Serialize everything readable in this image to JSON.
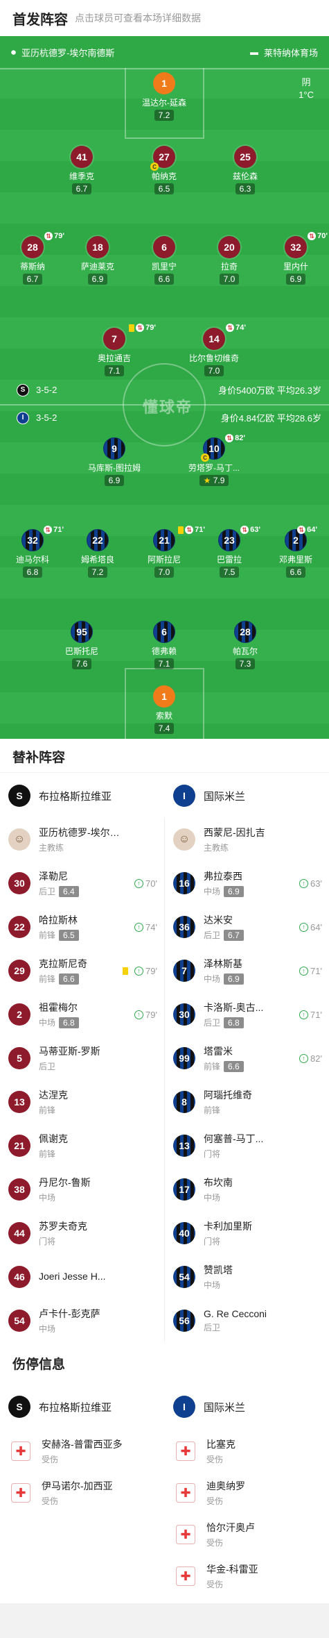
{
  "header": {
    "title": "首发阵容",
    "subtitle": "点击球员可查看本场详细数据"
  },
  "pitch": {
    "home_coach_label": "亚历杭德罗-埃尔南德斯",
    "stadium": "莱特纳体育场",
    "weather": {
      "condition": "阴",
      "temp": "1°C"
    },
    "watermark": "懂球帝",
    "home_formation": "3-5-2",
    "away_formation": "3-5-2",
    "home_stats": "身价5400万欧  平均26.3岁",
    "away_stats": "身价4.84亿欧  平均28.6岁",
    "home_logo": "S",
    "away_logo": "I"
  },
  "home_players": [
    {
      "num": "1",
      "name": "温达尔-延森",
      "rating": "7.2",
      "gk": true
    },
    {
      "num": "41",
      "name": "维季克",
      "rating": "6.7"
    },
    {
      "num": "27",
      "name": "帕纳克",
      "rating": "6.5",
      "captain": true
    },
    {
      "num": "25",
      "name": "兹伦森",
      "rating": "6.3"
    },
    {
      "num": "28",
      "name": "蒂斯纳",
      "rating": "6.7",
      "sub": "79'"
    },
    {
      "num": "18",
      "name": "萨迪莱克",
      "rating": "6.9"
    },
    {
      "num": "6",
      "name": "凯里宁",
      "rating": "6.6"
    },
    {
      "num": "20",
      "name": "拉奇",
      "rating": "7.0"
    },
    {
      "num": "32",
      "name": "里内什",
      "rating": "6.9",
      "sub": "70'"
    },
    {
      "num": "7",
      "name": "奥拉通吉",
      "rating": "7.1",
      "sub": "79'",
      "yellow": true
    },
    {
      "num": "14",
      "name": "比尔鲁切维奇",
      "rating": "7.0",
      "sub": "74'"
    }
  ],
  "away_players": [
    {
      "num": "9",
      "name": "马库斯-图拉姆",
      "rating": "6.9"
    },
    {
      "num": "10",
      "name": "劳塔罗-马丁...",
      "rating": "7.9",
      "sub": "82'",
      "captain": true,
      "star": true
    },
    {
      "num": "32",
      "name": "迪马尔科",
      "rating": "6.8",
      "sub": "71'"
    },
    {
      "num": "22",
      "name": "姆希塔良",
      "rating": "7.2"
    },
    {
      "num": "21",
      "name": "阿斯拉尼",
      "rating": "7.0",
      "sub": "71'",
      "yellow": true
    },
    {
      "num": "23",
      "name": "巴雷拉",
      "rating": "7.5",
      "sub": "63'"
    },
    {
      "num": "2",
      "name": "邓弗里斯",
      "rating": "6.6",
      "sub": "64'"
    },
    {
      "num": "95",
      "name": "巴斯托尼",
      "rating": "7.6"
    },
    {
      "num": "6",
      "name": "德弗赖",
      "rating": "7.1"
    },
    {
      "num": "28",
      "name": "帕瓦尔",
      "rating": "7.3"
    },
    {
      "num": "1",
      "name": "索默",
      "rating": "7.4",
      "gk": true
    }
  ],
  "subs_section": {
    "title": "替补阵容",
    "home_team": "布拉格斯拉维亚",
    "away_team": "国际米兰",
    "home_coach": {
      "name": "亚历杭德罗-埃尔南德斯",
      "role": "主教练"
    },
    "away_coach": {
      "name": "西蒙尼-因扎吉",
      "role": "主教练"
    },
    "home": [
      {
        "num": "30",
        "name": "泽勒尼",
        "pos": "后卫",
        "rating": "6.4",
        "in": "70'"
      },
      {
        "num": "22",
        "name": "哈拉斯林",
        "pos": "前锋",
        "rating": "6.5",
        "in": "74'"
      },
      {
        "num": "29",
        "name": "克拉斯尼奇",
        "pos": "前锋",
        "rating": "6.6",
        "in": "79'",
        "yellow": true
      },
      {
        "num": "2",
        "name": "祖霍梅尔",
        "pos": "中场",
        "rating": "6.8",
        "in": "79'"
      },
      {
        "num": "5",
        "name": "马蒂亚斯-罗斯",
        "pos": "后卫"
      },
      {
        "num": "13",
        "name": "达涅克",
        "pos": "前锋"
      },
      {
        "num": "21",
        "name": "佩谢克",
        "pos": "前锋"
      },
      {
        "num": "38",
        "name": "丹尼尔-鲁斯",
        "pos": "中场"
      },
      {
        "num": "44",
        "name": "苏罗夫奇克",
        "pos": "门将"
      },
      {
        "num": "46",
        "name": "Joeri Jesse H...",
        "pos": ""
      },
      {
        "num": "54",
        "name": "卢卡什-彭克萨",
        "pos": "中场"
      }
    ],
    "away": [
      {
        "num": "16",
        "name": "弗拉泰西",
        "pos": "中场",
        "rating": "6.9",
        "in": "63'"
      },
      {
        "num": "36",
        "name": "达米安",
        "pos": "后卫",
        "rating": "6.7",
        "in": "64'"
      },
      {
        "num": "7",
        "name": "泽林斯基",
        "pos": "中场",
        "rating": "6.9",
        "in": "71'"
      },
      {
        "num": "30",
        "name": "卡洛斯-奥古...",
        "pos": "后卫",
        "rating": "6.8",
        "in": "71'"
      },
      {
        "num": "99",
        "name": "塔雷米",
        "pos": "前锋",
        "rating": "6.6",
        "in": "82'"
      },
      {
        "num": "8",
        "name": "阿瑙托维奇",
        "pos": "前锋"
      },
      {
        "num": "13",
        "name": "何塞普-马丁...",
        "pos": "门将"
      },
      {
        "num": "17",
        "name": "布坎南",
        "pos": "中场"
      },
      {
        "num": "40",
        "name": "卡利加里斯",
        "pos": "门将"
      },
      {
        "num": "54",
        "name": "赞凯塔",
        "pos": "中场"
      },
      {
        "num": "56",
        "name": "G. Re Cecconi",
        "pos": "后卫"
      }
    ]
  },
  "injury_section": {
    "title": "伤停信息",
    "home_team": "布拉格斯拉维亚",
    "away_team": "国际米兰",
    "home": [
      {
        "name": "安赫洛-普雷西亚多",
        "status": "受伤"
      },
      {
        "name": "伊马诺尔-加西亚",
        "status": "受伤"
      }
    ],
    "away": [
      {
        "name": "比塞克",
        "status": "受伤"
      },
      {
        "name": "迪奥纳罗",
        "status": "受伤"
      },
      {
        "name": "恰尔汗奥卢",
        "status": "受伤"
      },
      {
        "name": "华金-科雷亚",
        "status": "受伤"
      }
    ]
  },
  "colors": {
    "home": "#8e1b2c",
    "away": "#0f3f8f",
    "pitch": "#2fa846",
    "gk": "#f07b1a"
  }
}
